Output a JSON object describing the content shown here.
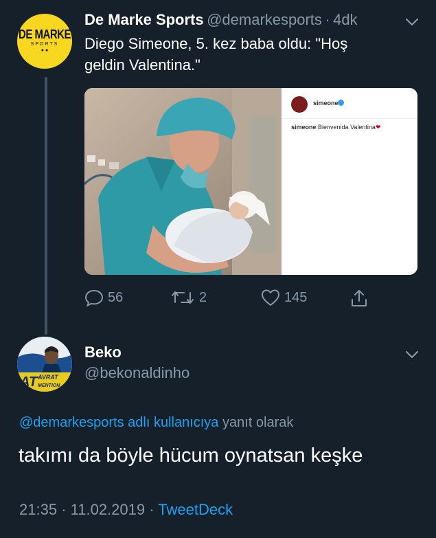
{
  "tweet": {
    "author_name": "De Marke Sports",
    "author_handle": "@demarkesports",
    "age_sep": "·",
    "age": "4dk",
    "text_line1": "Diego Simeone, 5. kez baba oldu: \"Hoş",
    "text_line2": "geldin Valentina.\"",
    "avatar_logo": "DE MARKE",
    "avatar_sub": "SPORTS",
    "media": {
      "ig_username": "simeone",
      "ig_caption_user": "simeone",
      "ig_caption_text": "Bienvenida Valentina"
    },
    "actions": {
      "replies": "56",
      "retweets": "2",
      "likes": "145"
    }
  },
  "reply": {
    "author_name": "Beko",
    "author_handle": "@bekonaldinho",
    "avatar_text": "AVRAT",
    "avatar_text_big": "AT",
    "avatar_text_small": "MENTION",
    "reply_to_link": "@demarkesports adlı kullanıcıya",
    "reply_to_suffix": "yanıt olarak",
    "text": "takımı da böyle hücum oynatsan keşke",
    "time": "21:35",
    "sep1": "·",
    "date": "11.02.2019",
    "sep2": "·",
    "client": "TweetDeck"
  },
  "colors": {
    "background": "#15202b",
    "muted": "#8899a6",
    "link": "#1da1f2",
    "thread_line": "#3d5466",
    "avatar_yellow": "#f7d71f"
  }
}
